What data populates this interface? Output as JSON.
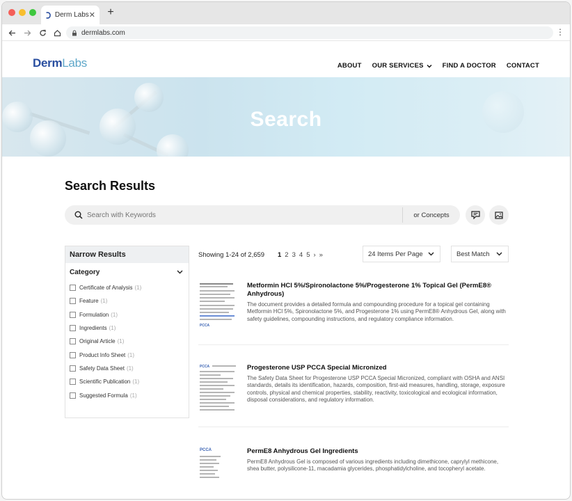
{
  "browser": {
    "tab_title": "Derm Labs",
    "tab_close": "✕",
    "new_tab": "+",
    "url": "dermlabs.com"
  },
  "site": {
    "logo_part1": "Derm",
    "logo_part2": "Labs",
    "nav": [
      {
        "label": "ABOUT"
      },
      {
        "label": "OUR SERVICES"
      },
      {
        "label": "FIND A DOCTOR"
      },
      {
        "label": "CONTACT"
      }
    ],
    "hero_title": "Search"
  },
  "search": {
    "heading": "Search Results",
    "placeholder": "Search with Keywords",
    "concepts_label": "or Concepts"
  },
  "sidebar": {
    "title": "Narrow Results",
    "category_title": "Category",
    "items": [
      {
        "label": "Certificate of Analysis",
        "count": "(1)"
      },
      {
        "label": "Feature",
        "count": "(1)"
      },
      {
        "label": "Formulation",
        "count": "(1)"
      },
      {
        "label": "Ingredients",
        "count": "(1)"
      },
      {
        "label": "Original Article",
        "count": "(1)"
      },
      {
        "label": "Product Info Sheet",
        "count": "(1)"
      },
      {
        "label": "Safety Data Sheet",
        "count": "(1)"
      },
      {
        "label": "Scientific Publication",
        "count": "(1)"
      },
      {
        "label": "Suggested Formula",
        "count": "(1)"
      }
    ]
  },
  "toolbar": {
    "showing": "Showing 1-24 of 2,659",
    "pages": [
      "1",
      "2",
      "3",
      "4",
      "5"
    ],
    "next": "›",
    "last": "»",
    "per_page": "24 Items Per Page",
    "sort": "Best Match"
  },
  "results": [
    {
      "title": "Metformin HCl 5%/Spironolactone 5%/Progesterone 1% Topical Gel (PermE8® Anhydrous)",
      "description": "The document provides a detailed formula and compounding procedure for a topical gel containing Metformin HCl 5%, Spironolactone 5%, and Progesterone 1% using PermE8® Anhydrous Gel, along with safety guidelines, compounding instructions, and regulatory compliance information.",
      "thumb_logo": "PCCA"
    },
    {
      "title": "Progesterone USP PCCA Special Micronized",
      "description": "The Safety Data Sheet for Progesterone USP PCCA Special Micronized, compliant with OSHA and ANSI standards, details its identification, hazards, composition, first-aid measures, handling, storage, exposure controls, physical and chemical properties, stability, reactivity, toxicological and ecological information, disposal considerations, and regulatory information.",
      "thumb_logo": "PCCA"
    },
    {
      "title": "PermE8 Anhydrous Gel Ingredients",
      "description": "PermE8 Anhydrous Gel is composed of various ingredients including dimethicone, caprylyl methicone, shea butter, polysilicone-11, macadamia glycerides, phosphatidylcholine, and tocopheryl acetate.",
      "thumb_logo": "PCCA"
    }
  ]
}
